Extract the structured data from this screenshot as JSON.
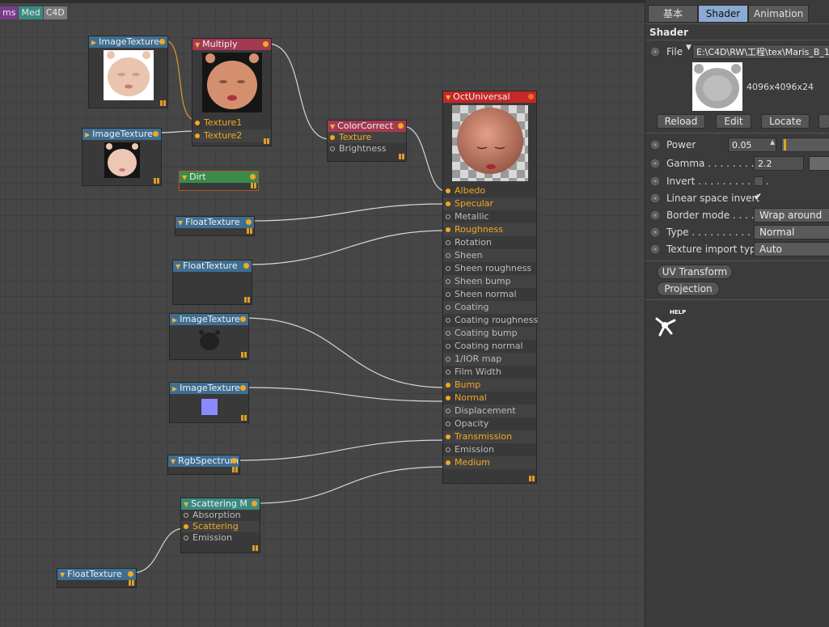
{
  "tags": [
    {
      "label": "ms",
      "color": "#7a3c8c"
    },
    {
      "label": "Med",
      "color": "#3a8a80"
    },
    {
      "label": "C4D",
      "color": "#7a7a7a"
    }
  ],
  "nodes": {
    "image1": {
      "title": "ImageTexture"
    },
    "multiply": {
      "title": "Multiply",
      "pins": [
        "Texture1",
        "Texture2"
      ]
    },
    "image2": {
      "title": "ImageTexture"
    },
    "dirt": {
      "title": "Dirt"
    },
    "colorcorrect": {
      "title": "ColorCorrect",
      "pins": [
        "Texture",
        "Brightness"
      ]
    },
    "float1": {
      "title": "FloatTexture"
    },
    "float2": {
      "title": "FloatTexture"
    },
    "image3": {
      "title": "ImageTexture"
    },
    "image4": {
      "title": "ImageTexture"
    },
    "rgb": {
      "title": "RgbSpectrum"
    },
    "scattering": {
      "title": "Scattering M",
      "pins": [
        "Absorption",
        "Scattering",
        "Emission"
      ]
    },
    "float3": {
      "title": "FloatTexture"
    },
    "octuniversal": {
      "title": "OctUniversal",
      "pins": [
        "Albedo",
        "Specular",
        "Metallic",
        "Roughness",
        "Rotation",
        "Sheen",
        "Sheen roughness",
        "Sheen bump",
        "Sheen normal",
        "Coating",
        "Coating roughness",
        "Coating bump",
        "Coating normal",
        "1/IOR map",
        "Film Width",
        "Bump",
        "Normal",
        "Displacement",
        "Opacity",
        "Transmission",
        "Emission",
        "Medium"
      ],
      "connected": [
        "Albedo",
        "Specular",
        "Roughness",
        "Bump",
        "Normal",
        "Transmission",
        "Medium"
      ]
    }
  },
  "panel": {
    "tabs": [
      "基本",
      "Shader",
      "Animation"
    ],
    "active_tab": "Shader",
    "title": "Shader",
    "file_label": "File",
    "file_path": "E:\\C4D\\RW\\工程\\tex\\Maris_B_1",
    "resolution": "4096x4096x24",
    "buttons": [
      "Reload",
      "Edit",
      "Locate"
    ],
    "power_label": "Power",
    "power_value": "0.05",
    "gamma_label": "Gamma . . . . . . . . . . .",
    "gamma_value": "2.2",
    "invert_label": "Invert . . . . . . . . . . . .",
    "linear_label": "Linear space invert",
    "border_label": "Border mode . . . . . .",
    "border_value": "Wrap around",
    "type_label": "Type . . . . . . . . . . . . . .",
    "type_value": "Normal",
    "import_label": "Texture import type",
    "import_value": "Auto",
    "uv_button": "UV Transform",
    "projection_button": "Projection",
    "help_label": "HELP"
  }
}
